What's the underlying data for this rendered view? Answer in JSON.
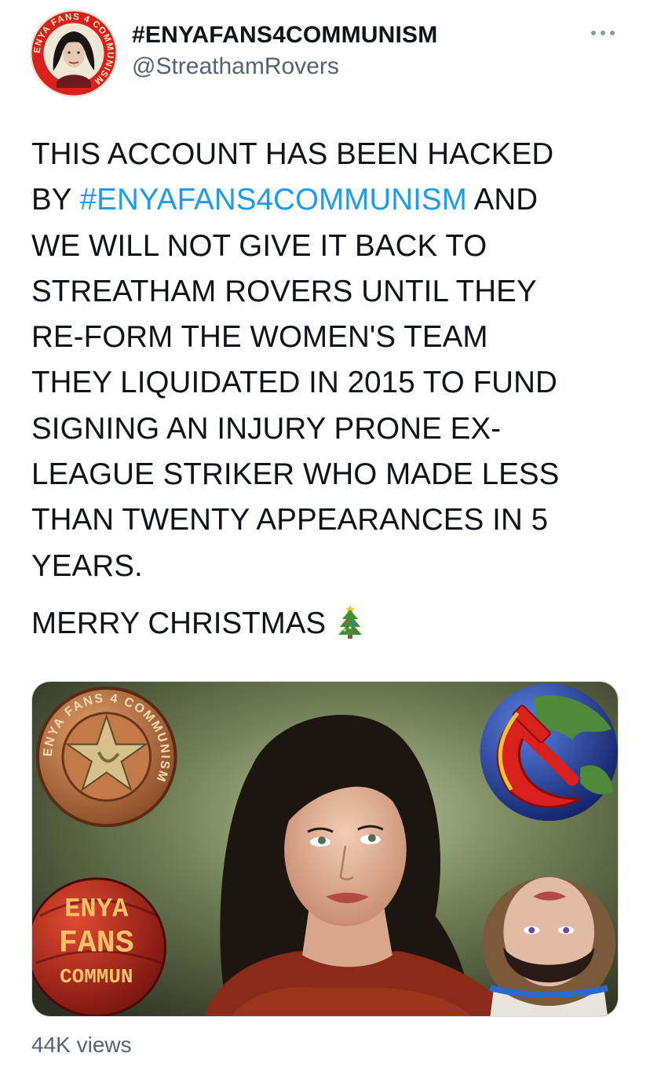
{
  "tweet": {
    "author": {
      "display_name": "#ENYAFANS4COMMUNISM",
      "handle": "@StreathamRovers",
      "avatar_ring_text": "ENYA FANS 4 COMMUNISM"
    },
    "more_icon": "more-horizontal-icon",
    "text_lines": [
      "THIS ACCOUNT HAS BEEN HACKED",
      "AND",
      "WE WILL NOT GIVE IT BACK TO",
      "STREATHAM ROVERS UNTIL THEY",
      "RE-FORM THE WOMEN'S TEAM",
      "THEY LIQUIDATED IN 2015 TO FUND",
      "SIGNING AN INJURY PRONE EX-",
      "LEAGUE STRIKER WHO MADE LESS",
      "THAN TWENTY APPEARANCES IN 5",
      "YEARS."
    ],
    "line2_prefix": "BY",
    "hashtag": "#ENYAFANS4COMMUNISM",
    "greeting": "MERRY CHRISTMAS",
    "greeting_emoji": "christmas-tree-icon",
    "media": {
      "badge_top_left_text": "ENYA FANS 4 COMMUNISM",
      "ball_bottom_left_lines": [
        "ENYA",
        "FANS",
        "COMMUN"
      ]
    },
    "views": "44K views"
  },
  "colors": {
    "text": "#0f1419",
    "secondary": "#536471",
    "link": "#1d9bf0",
    "avatar_ring_red": "#d8201c"
  }
}
